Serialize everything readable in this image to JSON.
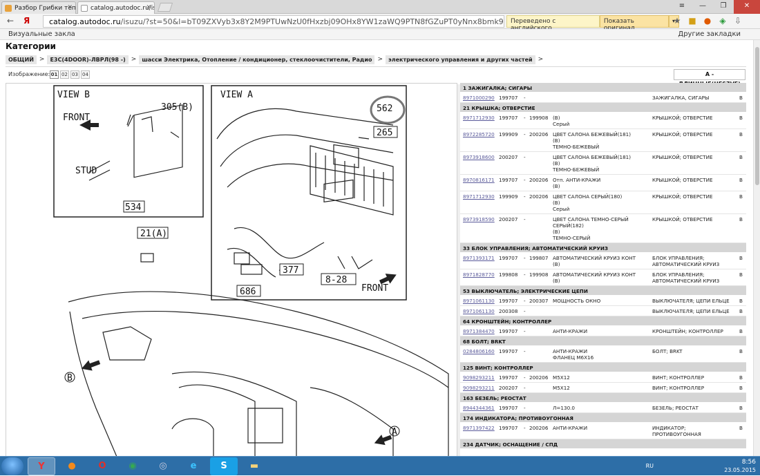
{
  "browser": {
    "tabs": [
      {
        "label": "Разбор Грибки тепер",
        "active": false
      },
      {
        "label": "catalog.autodoc.ru/isu",
        "active": true
      }
    ],
    "url": {
      "host": "catalog.autodoc.ru",
      "path": "/isuzu/?st=50&l=bT09ZXVyb3x8Y2M9PTUwNzU0fHxzbj09OHx8YW1zaWQ9PTN8fGZuPT0yNnx8bmk9..."
    },
    "translate": {
      "status": "Переведено с английского",
      "show_original": "Показать оригинал"
    },
    "bookmarks_left": "Визуальные закла",
    "bookmarks_right": "Другие закладки"
  },
  "page": {
    "title": "Категории",
    "breadcrumbs": [
      "ОБЩИЙ",
      "E3C(4DOOR)-ЛВРЛ(98 -)",
      "шасси Электрика, Отопление / кондиционер, стеклоочистители, Радио",
      "электрического управления и других частей"
    ],
    "image_label": "Изображение:",
    "image_pages": [
      "01",
      "02",
      "03",
      "04"
    ],
    "active_page": "01",
    "variant": "A - ДЛИННЫЕ(UES7VF)"
  },
  "diagram": {
    "labels": [
      "VIEW B",
      "FRONT",
      "305(B)",
      "STUD",
      "534",
      "VIEW A",
      "562",
      "265",
      "21(A)",
      "377",
      "686",
      "8-28",
      "FRONT",
      "B",
      "A"
    ]
  },
  "parts": [
    {
      "group": "1 ЗАЖИГАЛКА; СИГАРЫ",
      "rows": [
        {
          "pn": "8971000290",
          "from": "199707",
          "to": "",
          "desc": "",
          "name": "ЗАЖИГАЛКА, СИГАРЫ",
          "b": "B"
        }
      ]
    },
    {
      "group": "21 КРЫШКА; ОТВЕРСТИЕ",
      "rows": [
        {
          "pn": "8971712930",
          "from": "199707",
          "to": "199908",
          "desc": "(B)\nСерый",
          "name": "КРЫШКОЙ; ОТВЕРСТИЕ",
          "b": "B"
        },
        {
          "pn": "8972285720",
          "from": "199909",
          "to": "200206",
          "desc": "ЦВЕТ САЛОНА БЕЖЕВЫЙ(181)\n(B)\nТЕМНО-БЕЖЕВЫЙ",
          "name": "КРЫШКОЙ; ОТВЕРСТИЕ",
          "b": "B"
        },
        {
          "pn": "8973918600",
          "from": "200207",
          "to": "",
          "desc": "ЦВЕТ САЛОНА БЕЖЕВЫЙ(181)\n(B)\nТЕМНО-БЕЖЕВЫЙ",
          "name": "КРЫШКОЙ; ОТВЕРСТИЕ",
          "b": "B"
        },
        {
          "pn": "8970816171",
          "from": "199707",
          "to": "200206",
          "desc": "Отп. АНТИ-КРАЖИ\n(B)",
          "name": "КРЫШКОЙ; ОТВЕРСТИЕ",
          "b": "B"
        },
        {
          "pn": "8971712930",
          "from": "199909",
          "to": "200206",
          "desc": "ЦВЕТ САЛОНА СЕРЫЙ(180)\n(B)\nСерый",
          "name": "КРЫШКОЙ; ОТВЕРСТИЕ",
          "b": "B"
        },
        {
          "pn": "8973918590",
          "from": "200207",
          "to": "",
          "desc": "ЦВЕТ САЛОНА ТЕМНО-СЕРЫЙ\nСЕРЫЙ(182)\n(B)\nТЕМНО-СЕРЫЙ",
          "name": "КРЫШКОЙ; ОТВЕРСТИЕ",
          "b": "B"
        }
      ]
    },
    {
      "group": "33 БЛОК УПРАВЛЕНИЯ; АВТОМАТИЧЕСКИЙ КРУИЗ",
      "rows": [
        {
          "pn": "8971393171",
          "from": "199707",
          "to": "199807",
          "desc": "АВТОМАТИЧЕСКИЙ КРУИЗ КОНТ\n(B)",
          "name": "БЛОК УПРАВЛЕНИЯ;\nАВТОМАТИЧЕСКИЙ КРУИЗ",
          "b": "B"
        },
        {
          "pn": "8971828770",
          "from": "199808",
          "to": "199908",
          "desc": "АВТОМАТИЧЕСКИЙ КРУИЗ КОНТ\n(B)",
          "name": "БЛОК УПРАВЛЕНИЯ;\nАВТОМАТИЧЕСКИЙ КРУИЗ",
          "b": "B"
        }
      ]
    },
    {
      "group": "53 ВЫКЛЮЧАТЕЛЬ; ЭЛЕКТРИЧЕСКИЕ ЦЕПИ",
      "rows": [
        {
          "pn": "8971061130",
          "from": "199707",
          "to": "200307",
          "desc": "МОЩНОСТЬ ОКНО",
          "name": "ВЫКЛЮЧАТЕЛЯ; ЦЕПИ ЕЛЬЦЕ",
          "b": "B"
        },
        {
          "pn": "8971061130",
          "from": "200308",
          "to": "",
          "desc": "",
          "name": "ВЫКЛЮЧАТЕЛЯ; ЦЕПИ ЕЛЬЦЕ",
          "b": "B"
        }
      ]
    },
    {
      "group": "64 КРОНШТЕЙН; КОНТРОЛЛЕР",
      "rows": [
        {
          "pn": "8971384470",
          "from": "199707",
          "to": "",
          "desc": "АНТИ-КРАЖИ",
          "name": "КРОНШТЕЙН; КОНТРОЛЛЕР",
          "b": "B"
        }
      ]
    },
    {
      "group": "68 БОЛТ; BRKT",
      "rows": [
        {
          "pn": "0284806160",
          "from": "199707",
          "to": "",
          "desc": "АНТИ-КРАЖИ\nФЛАНЕЦ М6Х16",
          "name": "БОЛТ; BRKT",
          "b": "B"
        }
      ]
    },
    {
      "group": "125 ВИНТ; КОНТРОЛЛЕР",
      "rows": [
        {
          "pn": "9098293211",
          "from": "199707",
          "to": "200206",
          "desc": "М5Х12",
          "name": "ВИНТ; КОНТРОЛЛЕР",
          "b": "B"
        },
        {
          "pn": "9098293211",
          "from": "200207",
          "to": "",
          "desc": "М5Х12",
          "name": "ВИНТ; КОНТРОЛЛЕР",
          "b": "B"
        }
      ]
    },
    {
      "group": "163 БЕЗЕЛЬ; РЕОСТАТ",
      "rows": [
        {
          "pn": "8944344361",
          "from": "199707",
          "to": "",
          "desc": "Л=130.0",
          "name": "БЕЗЕЛЬ; РЕОСТАТ",
          "b": "B"
        }
      ]
    },
    {
      "group": "174 ИНДИКАТОРА; ПРОТИВОУГОННАЯ",
      "rows": [
        {
          "pn": "8971397422",
          "from": "199707",
          "to": "200206",
          "desc": "АНТИ-КРАЖИ",
          "name": "ИНДИКАТОР;\nПРОТИВОУГОННАЯ",
          "b": "B"
        }
      ]
    },
    {
      "group": "234 ДАТЧИК; ОСНАЩЕНИЕ / СПД",
      "rows": []
    }
  ],
  "taskbar": {
    "lang": "RU",
    "time": "8:56",
    "date": "23.05.2015"
  }
}
